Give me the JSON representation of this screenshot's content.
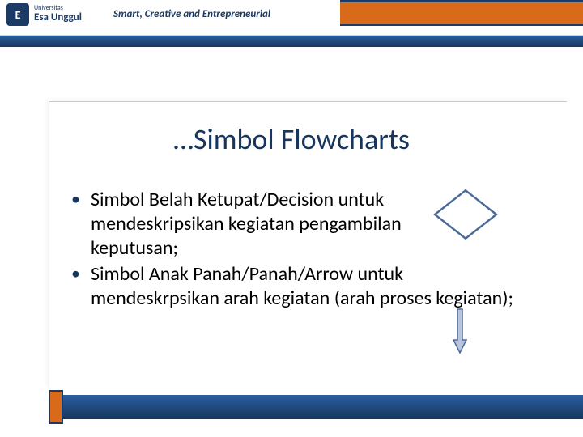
{
  "header": {
    "logo_name": "Esa Unggul",
    "logo_prefix": "Universitas",
    "tagline": "Smart, Creative and Entrepreneurial"
  },
  "slide": {
    "title": "…Simbol Flowcharts",
    "bullets": [
      "Simbol Belah Ketupat/Decision untuk mendeskripsikan kegiatan pengambilan keputusan;",
      "Simbol Anak Panah/Panah/Arrow untuk mendeskrpsikan arah kegiatan (arah proses kegiatan);"
    ]
  }
}
